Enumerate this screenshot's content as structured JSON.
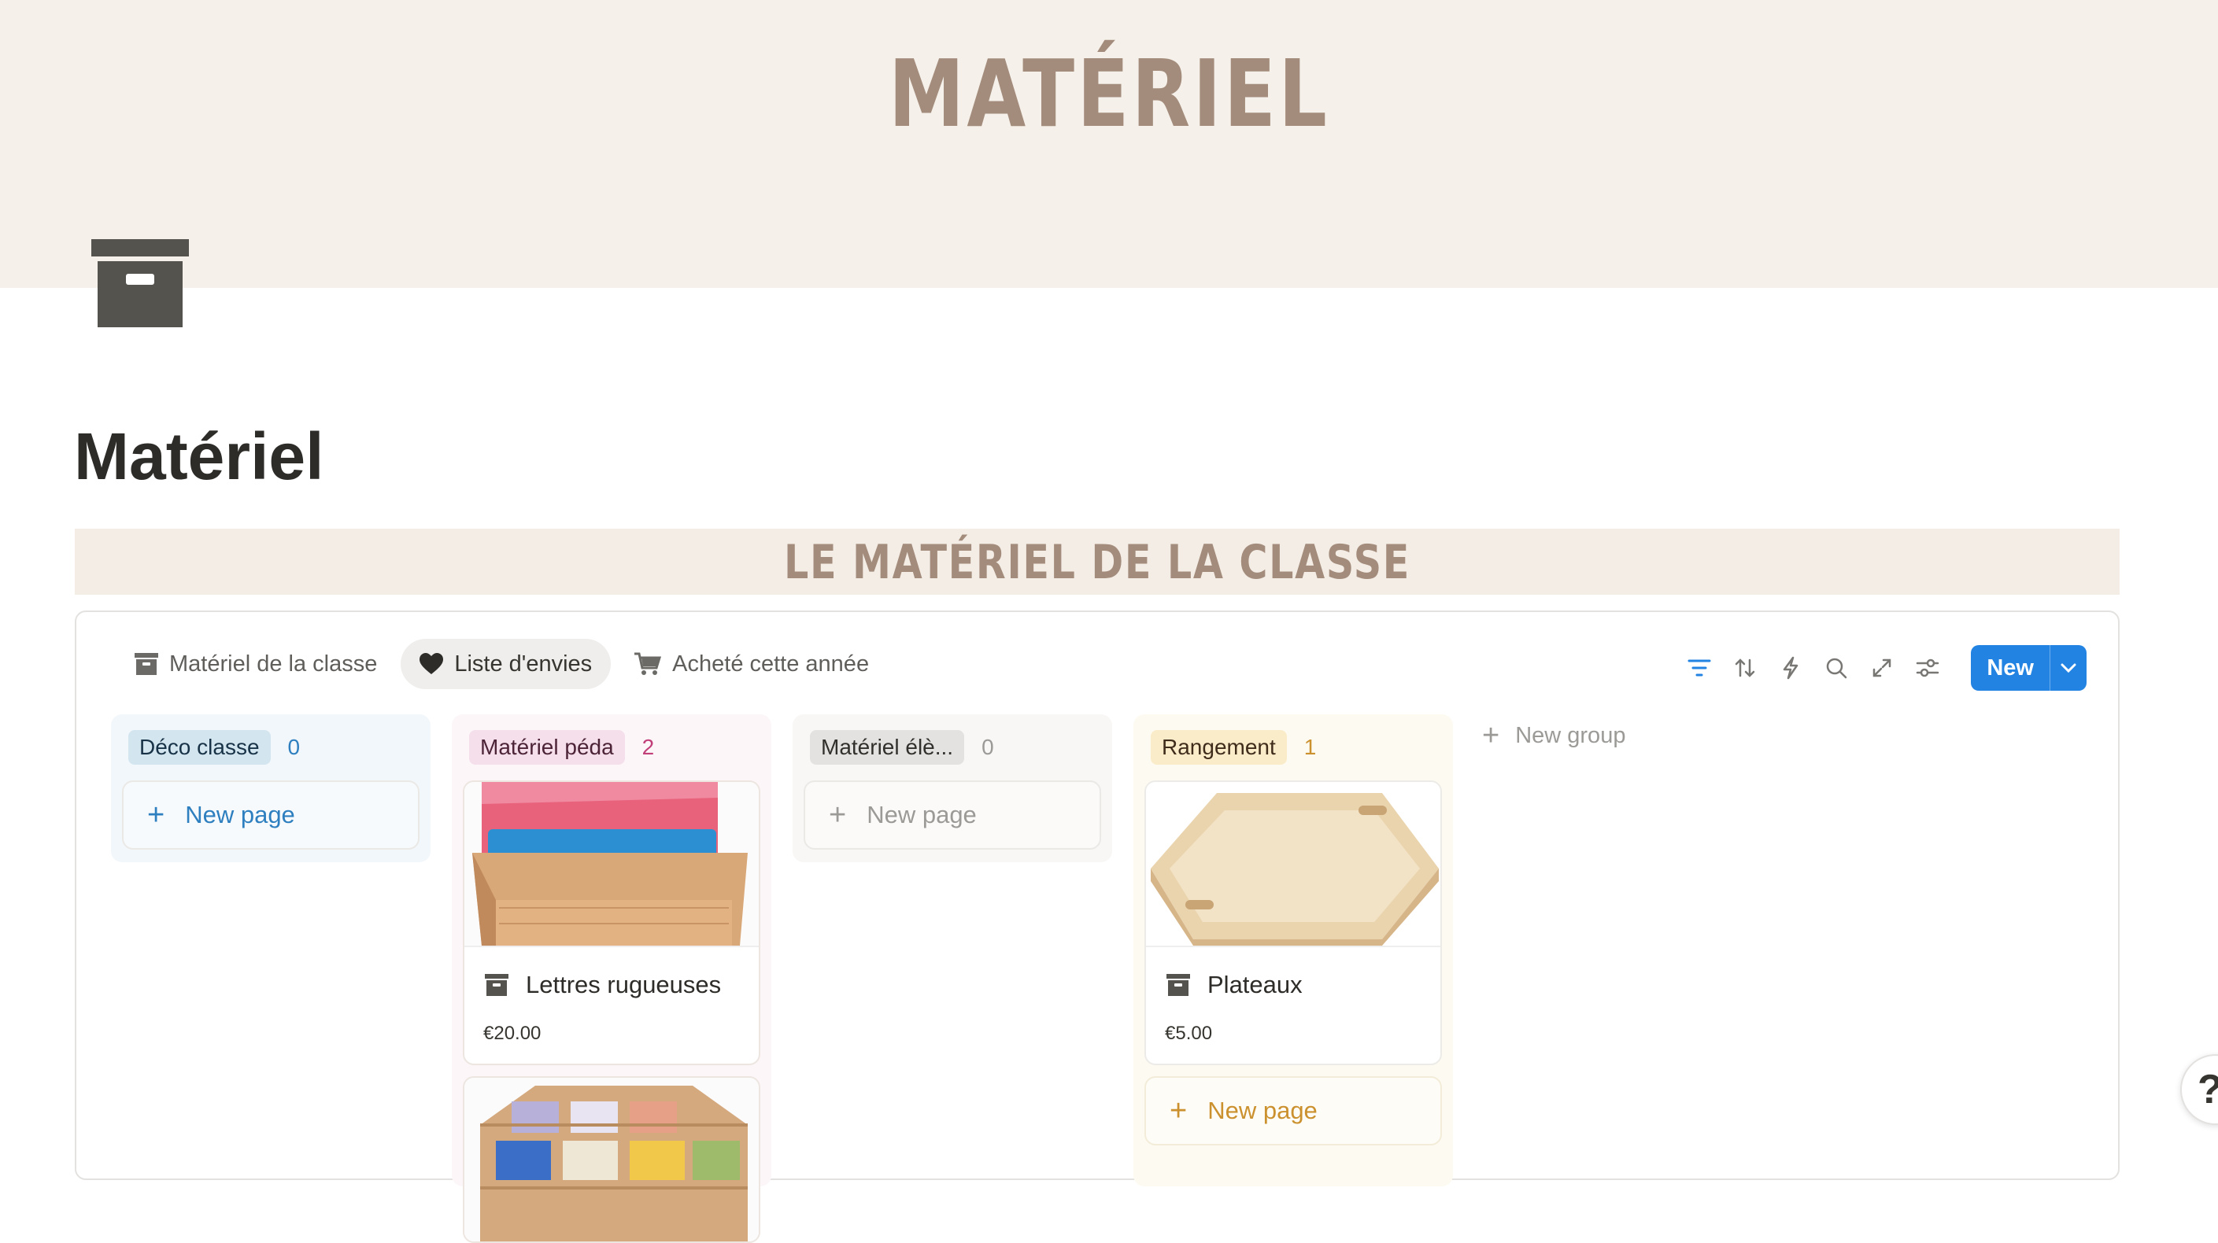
{
  "cover": {
    "title": "MATÉRIEL"
  },
  "page": {
    "title": "Matériel",
    "icon": "archive-box-icon"
  },
  "banner": {
    "text": "LE MATÉRIEL DE LA CLASSE"
  },
  "views": {
    "tabs": [
      {
        "label": "Matériel de la classe",
        "icon": "archive-box-icon"
      },
      {
        "label": "Liste d'envies",
        "icon": "heart-icon",
        "active": true
      },
      {
        "label": "Acheté cette année",
        "icon": "cart-icon"
      }
    ]
  },
  "toolbar": {
    "icons": [
      "filter-icon",
      "sort-icon",
      "automation-icon",
      "search-icon",
      "expand-icon",
      "settings-icon"
    ],
    "new_label": "New"
  },
  "board": {
    "columns": [
      {
        "label": "Déco classe",
        "count": "0",
        "new_page": "New page",
        "pill_color": "#d3e5ef",
        "text_color": "#183347",
        "count_color": "#2e7fbf",
        "bg": "#f2f7fb"
      },
      {
        "label": "Matériel péda",
        "count": "2",
        "pill_color": "#f4dfeb",
        "text_color": "#4c2337",
        "count_color": "#c1407a",
        "bg": "#fdf6f9",
        "cards": [
          {
            "title": "Lettres rugueuses",
            "price": "€20.00",
            "image": "sandpaper-letters-box"
          },
          {
            "title": "",
            "price": "",
            "image": "colored-beads-tray"
          }
        ]
      },
      {
        "label": "Matériel élè...",
        "count": "0",
        "new_page": "New page",
        "pill_color": "#e3e2e0",
        "text_color": "#32302c",
        "count_color": "#9b9a97",
        "bg": "#f8f7f6"
      },
      {
        "label": "Rangement",
        "count": "1",
        "new_page": "New page",
        "pill_color": "#fbecc9",
        "text_color": "#402c1b",
        "count_color": "#cb912f",
        "bg": "#fdfaf1",
        "cards": [
          {
            "title": "Plateaux",
            "price": "€5.00",
            "image": "wooden-tray"
          }
        ]
      }
    ],
    "new_group": "New group"
  },
  "help": {
    "label": "?"
  }
}
